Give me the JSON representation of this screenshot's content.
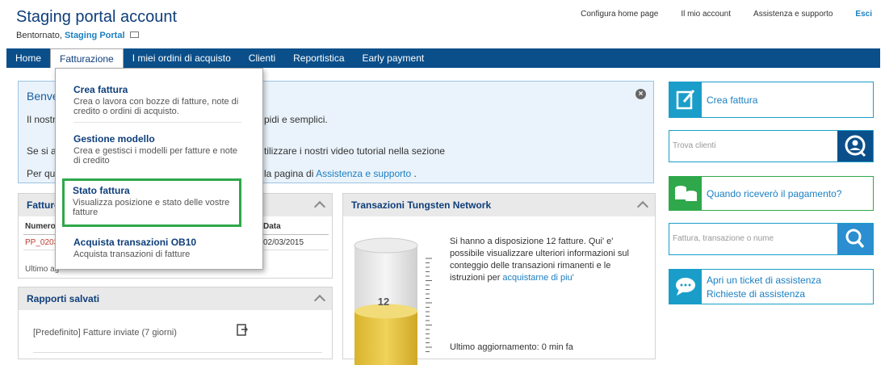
{
  "header": {
    "title": "Staging portal account",
    "welcome_prefix": "Bentornato,",
    "user_name": "Staging Portal",
    "links": [
      "Configura home page",
      "Il mio account",
      "Assistenza e supporto"
    ],
    "exit": "Esci"
  },
  "nav": {
    "items": [
      "Home",
      "Fatturazione",
      "I miei ordini di acquisto",
      "Clienti",
      "Reportistica",
      "Early payment"
    ],
    "active_index": 1
  },
  "welcome_box": {
    "title": "Benve",
    "line1_left": "Il nostr",
    "line1_right": "pidi e semplici.",
    "line2_left": "Se si a",
    "line2_right": "tilizzare i nostri video tutorial nella sezione",
    "line3_left": "Per qu",
    "line3_mid": "la pagina di ",
    "line3_link": "Assistenza e supporto",
    "line3_end": " ."
  },
  "invoices_panel": {
    "title": "Fatture",
    "col_number": "Numero",
    "col_date": "Data",
    "row_number": "PP_0203",
    "row_date": "02/03/2015",
    "footer": "Ultimo ag"
  },
  "dropdown": {
    "items": [
      {
        "title": "Crea fattura",
        "desc": "Crea o lavora con bozze di fatture, note di credito o ordini di acquisto."
      },
      {
        "title": "Gestione modello",
        "desc": "Crea e gestisci i modelli per fatture e note di credito"
      },
      {
        "title": "Stato fattura",
        "desc": "Visualizza posizione e stato delle vostre fatture"
      },
      {
        "title": "Acquista transazioni OB10",
        "desc": "Acquista transazioni di fatture"
      }
    ],
    "selected_index": 2
  },
  "reports_panel": {
    "title": "Rapporti salvati",
    "item": "[Predefinito] Fatture inviate (7 giorni)"
  },
  "transactions_panel": {
    "title": "Transazioni Tungsten Network",
    "count": "12",
    "fill_fraction": 0.45,
    "text": "Si hanno a disposizione 12 fatture. Qui' e' possibile visualizzare ulteriori informazioni sul conteggio delle transazioni rimanenti e le istruzioni per ",
    "link": "acquistarne di piu'",
    "updated": "Ultimo aggiornamento: 0 min fa"
  },
  "right": {
    "create_invoice": "Crea fattura",
    "find_clients_placeholder": "Trova clienti",
    "payment_when": "Quando riceverò il pagamento?",
    "search_placeholder": "Fattura, transazione o nume",
    "ticket_open": "Apri un ticket di assistenza",
    "ticket_requests": "Richieste di assistenza"
  },
  "colors": {
    "nav_bg": "#0b4f8a",
    "accent_blue": "#1a9ec9",
    "accent_green": "#2ea84a",
    "link": "#1a7fc1",
    "fill_yellow": "#e6c23a"
  }
}
